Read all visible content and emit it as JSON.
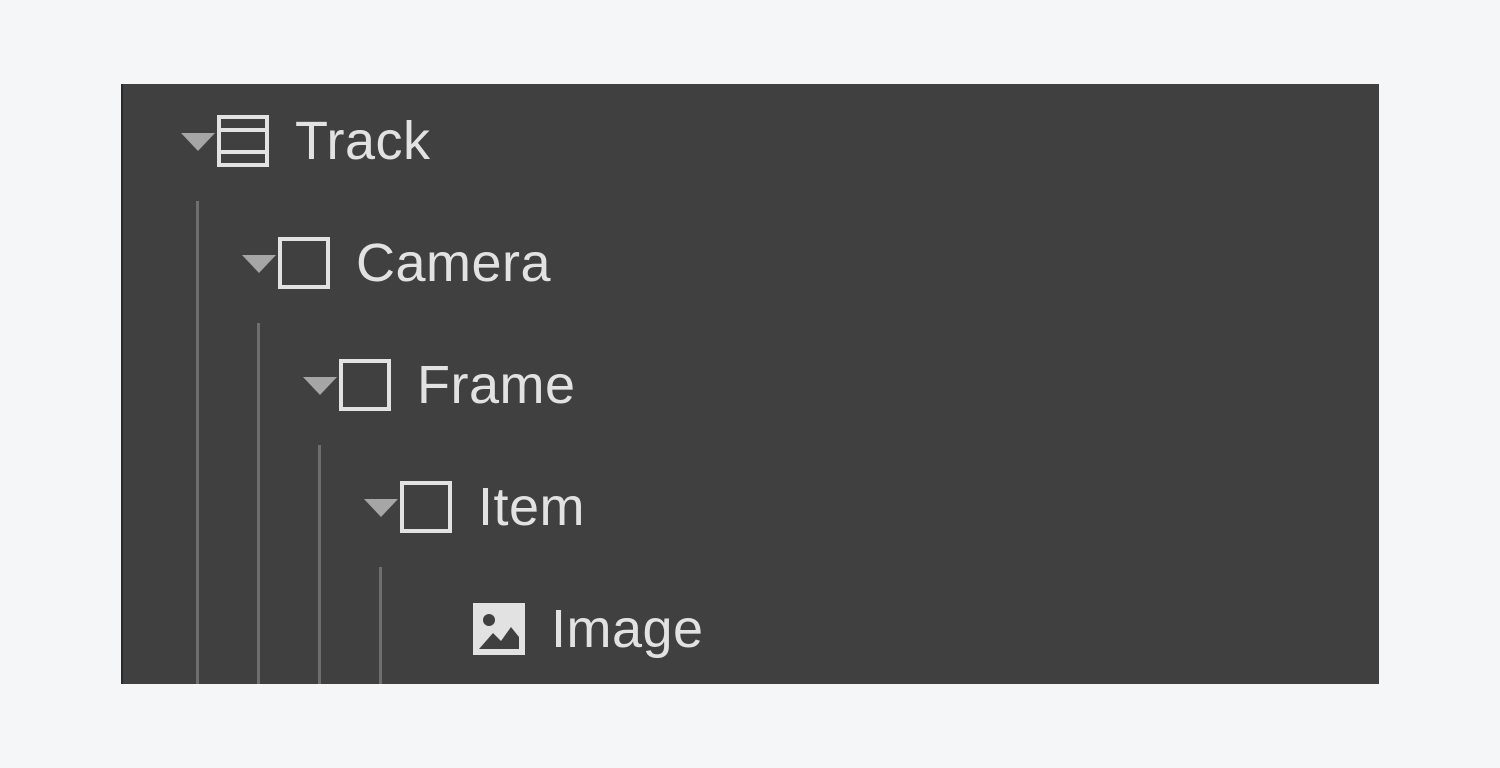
{
  "navigator": {
    "items": [
      {
        "label": "Track",
        "icon": "slider-track-icon",
        "expandable": true
      },
      {
        "label": "Camera",
        "icon": "box-icon",
        "expandable": true
      },
      {
        "label": "Frame",
        "icon": "box-icon",
        "expandable": true
      },
      {
        "label": "Item",
        "icon": "box-icon",
        "expandable": true
      },
      {
        "label": "Image",
        "icon": "image-icon",
        "expandable": false
      }
    ]
  },
  "colors": {
    "page_background": "#f5f6f8",
    "panel_background": "#404040",
    "text": "#e2e2e2",
    "guide_line": "#6e6e6e",
    "caret": "#a6a6a6"
  }
}
